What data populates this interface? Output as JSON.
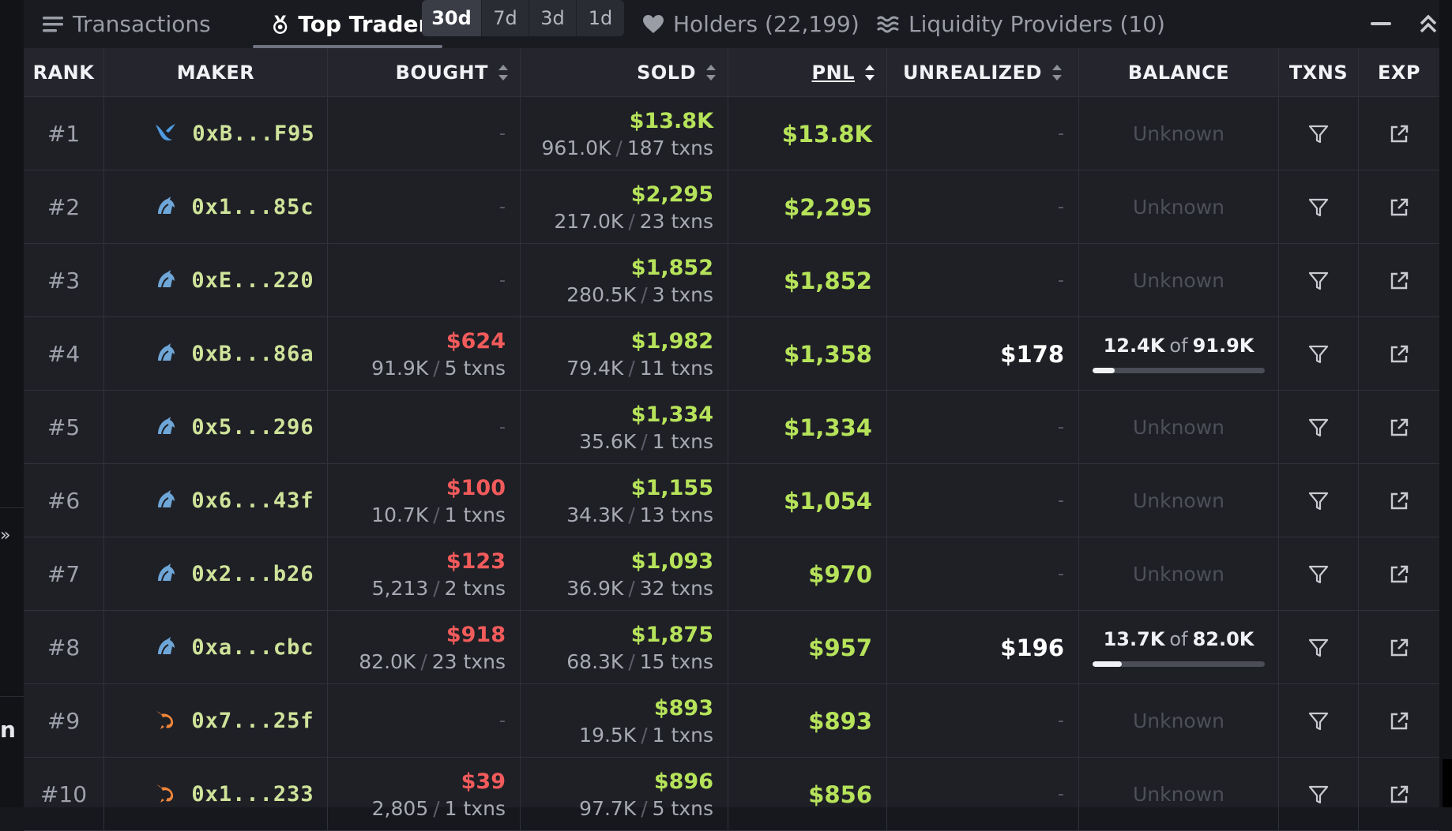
{
  "tabs": {
    "transactions": "Transactions",
    "top_traders": "Top Traders",
    "periods": [
      "30d",
      "7d",
      "3d",
      "1d"
    ],
    "holders": "Holders (22,199)",
    "liquidity": "Liquidity Providers (10)"
  },
  "columns": {
    "rank": "RANK",
    "maker": "MAKER",
    "bought": "BOUGHT",
    "sold": "SOLD",
    "pnl": "PNL",
    "unrealized": "UNREALIZED",
    "balance": "BALANCE",
    "txns": "TXNS",
    "exp": "EXP"
  },
  "labels": {
    "dash": "-",
    "unknown": "Unknown",
    "of": "of",
    "sep": "/"
  },
  "colors": {
    "green": "#b6e35a",
    "red": "#f25b5b",
    "address": "#cfe39a",
    "dolphin_icon": "#6fa6d8",
    "shrimp_icon": "#f0863a",
    "whale_icon": "#4f9be0"
  },
  "edge": {
    "left_char": "n"
  },
  "rows": [
    {
      "rank": "#1",
      "icon": "whale-icon",
      "maker": "0xB...F95",
      "bought": null,
      "bought_vol": "",
      "bought_txns": "",
      "sold": "$13.8K",
      "sold_vol": "961.0K",
      "sold_txns": "187 txns",
      "pnl": "$13.8K",
      "unrealized": null,
      "balance": null
    },
    {
      "rank": "#2",
      "icon": "dolphin-icon",
      "maker": "0x1...85c",
      "bought": null,
      "bought_vol": "",
      "bought_txns": "",
      "sold": "$2,295",
      "sold_vol": "217.0K",
      "sold_txns": "23 txns",
      "pnl": "$2,295",
      "unrealized": null,
      "balance": null
    },
    {
      "rank": "#3",
      "icon": "dolphin-icon",
      "maker": "0xE...220",
      "bought": null,
      "bought_vol": "",
      "bought_txns": "",
      "sold": "$1,852",
      "sold_vol": "280.5K",
      "sold_txns": "3 txns",
      "pnl": "$1,852",
      "unrealized": null,
      "balance": null
    },
    {
      "rank": "#4",
      "icon": "dolphin-icon",
      "maker": "0xB...86a",
      "bought": "$624",
      "bought_vol": "91.9K",
      "bought_txns": "5 txns",
      "sold": "$1,982",
      "sold_vol": "79.4K",
      "sold_txns": "11 txns",
      "pnl": "$1,358",
      "unrealized": "$178",
      "balance": {
        "held": "12.4K",
        "total": "91.9K",
        "fraction": 0.13
      }
    },
    {
      "rank": "#5",
      "icon": "dolphin-icon",
      "maker": "0x5...296",
      "bought": null,
      "bought_vol": "",
      "bought_txns": "",
      "sold": "$1,334",
      "sold_vol": "35.6K",
      "sold_txns": "1 txns",
      "pnl": "$1,334",
      "unrealized": null,
      "balance": null
    },
    {
      "rank": "#6",
      "icon": "dolphin-icon",
      "maker": "0x6...43f",
      "bought": "$100",
      "bought_vol": "10.7K",
      "bought_txns": "1 txns",
      "sold": "$1,155",
      "sold_vol": "34.3K",
      "sold_txns": "13 txns",
      "pnl": "$1,054",
      "unrealized": null,
      "balance": null
    },
    {
      "rank": "#7",
      "icon": "dolphin-icon",
      "maker": "0x2...b26",
      "bought": "$123",
      "bought_vol": "5,213",
      "bought_txns": "2 txns",
      "sold": "$1,093",
      "sold_vol": "36.9K",
      "sold_txns": "32 txns",
      "pnl": "$970",
      "unrealized": null,
      "balance": null
    },
    {
      "rank": "#8",
      "icon": "dolphin-icon",
      "maker": "0xa...cbc",
      "bought": "$918",
      "bought_vol": "82.0K",
      "bought_txns": "23 txns",
      "sold": "$1,875",
      "sold_vol": "68.3K",
      "sold_txns": "15 txns",
      "pnl": "$957",
      "unrealized": "$196",
      "balance": {
        "held": "13.7K",
        "total": "82.0K",
        "fraction": 0.17
      }
    },
    {
      "rank": "#9",
      "icon": "shrimp-icon",
      "maker": "0x7...25f",
      "bought": null,
      "bought_vol": "",
      "bought_txns": "",
      "sold": "$893",
      "sold_vol": "19.5K",
      "sold_txns": "1 txns",
      "pnl": "$893",
      "unrealized": null,
      "balance": null
    },
    {
      "rank": "#10",
      "icon": "shrimp-icon",
      "maker": "0x1...233",
      "bought": "$39",
      "bought_vol": "2,805",
      "bought_txns": "1 txns",
      "sold": "$896",
      "sold_vol": "97.7K",
      "sold_txns": "5 txns",
      "pnl": "$856",
      "unrealized": null,
      "balance": null
    }
  ]
}
